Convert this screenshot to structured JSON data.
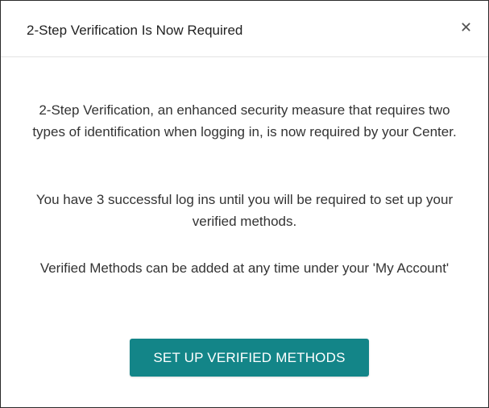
{
  "modal": {
    "title": "2-Step Verification Is Now Required",
    "close_icon": "close-icon",
    "messages": [
      "2-Step Verification, an enhanced security measure that requires two types of identification when logging in, is now required by your Center.",
      "You have 3 successful log ins until you will be required to set up your verified methods.",
      "Verified Methods can be added at any time under your 'My Account'"
    ],
    "primary_button_label": "SET UP VERIFIED METHODS"
  },
  "colors": {
    "accent": "#138588",
    "title_text": "#222222",
    "body_text": "#333333",
    "divider": "#e3e3e3",
    "border": "#2a2a2a"
  }
}
